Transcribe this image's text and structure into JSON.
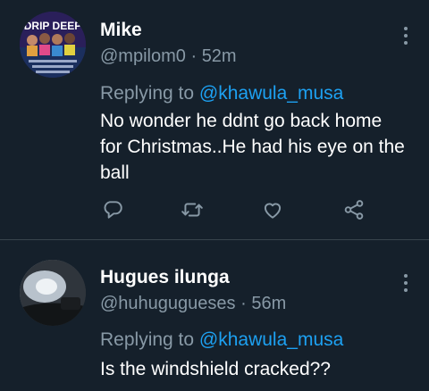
{
  "tweets": [
    {
      "name": "Mike",
      "handle": "@mpilom0",
      "separator": "·",
      "time": "52m",
      "replying_prefix": "Replying to",
      "replying_to": "@khawula_musa",
      "text": "No wonder he ddnt go back home for Christmas..He had his eye on the ball",
      "avatar_text": "DRIP DEEP",
      "icons": [
        "reply-icon",
        "retweet-icon",
        "like-icon",
        "share-icon",
        "more-icon"
      ]
    },
    {
      "name": "Hugues ilunga",
      "handle": "@huhugugueses",
      "separator": "·",
      "time": "56m",
      "replying_prefix": "Replying to",
      "replying_to": "@khawula_musa",
      "text": "Is the windshield cracked??",
      "icons": [
        "more-icon"
      ]
    }
  ],
  "colors": {
    "background": "#15202b",
    "secondary_text": "#8899a6",
    "link": "#1da1f2",
    "divider": "#38444d"
  }
}
